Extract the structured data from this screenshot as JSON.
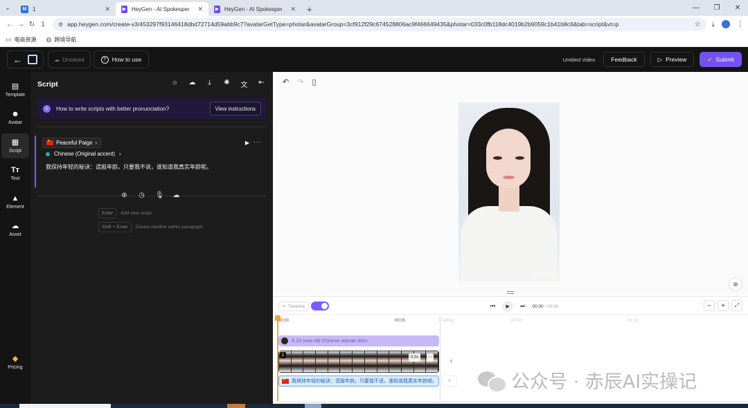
{
  "browser": {
    "tabs": [
      {
        "title": "1",
        "favicon": "1-favicon",
        "active": false
      },
      {
        "title": "HeyGen - AI Spokesperson V",
        "favicon": "heygen-favicon",
        "active": true
      },
      {
        "title": "HeyGen - AI Spokesperson V",
        "favicon": "heygen-favicon",
        "active": false
      }
    ],
    "reload_count": "1",
    "url": "app.heygen.com/create-v3/453297f93146418dbd72714d59abb9c7?avatarGetType=photar&avatarGroup=3cf912f29c674528806ac9f466649435&photar=033c0fb118dc4019b2b9059c1b41b8c6&tab=script&vt=p",
    "bookmarks": [
      "电商资源",
      "跨境导航"
    ]
  },
  "header": {
    "unsaved": "Unsaved",
    "how_to_use": "How to use",
    "video_title": "Untitled Video",
    "feedback": "Feedback",
    "preview": "Preview",
    "submit": "Submit"
  },
  "rail": {
    "items": [
      {
        "label": "Template",
        "icon": "template-icon"
      },
      {
        "label": "Avatar",
        "icon": "avatar-icon"
      },
      {
        "label": "Script",
        "icon": "script-icon",
        "active": true
      },
      {
        "label": "Text",
        "icon": "text-icon"
      },
      {
        "label": "Element",
        "icon": "element-icon"
      },
      {
        "label": "Asset",
        "icon": "asset-icon"
      }
    ],
    "pricing": "Pricing"
  },
  "script_panel": {
    "title": "Script",
    "tip_text": "How to write scripts with better pronunciation?",
    "tip_button": "View instructions",
    "voice_name": "Peaceful Paige",
    "accent": "Chinese (Original accent)",
    "script_text": "我保持年轻的秘诀：谎报年龄。只要我不说，谁知道我真实年龄呢。",
    "shortcuts": [
      {
        "key": "Enter",
        "desc": "Add new script"
      },
      {
        "key": "Shift + Enter",
        "desc": "Create newline within paragraph"
      }
    ]
  },
  "canvas": {
    "watermark": "HeyGen"
  },
  "timeline": {
    "mode_label": "Timeline",
    "current_time": "00:00",
    "duration": "/ 00:06",
    "ruler": [
      "00:00",
      "00:05",
      "Loading",
      "00:10",
      "00:15"
    ],
    "avatar_track_label": "A 23-year-old Chinese woman dres",
    "video_track_number": "1",
    "video_track_duration": "0.0s",
    "video_track_more": "···",
    "script_track_label": "我保持年轻的秘诀：谎报年龄。只要我不说，谁知道我真实年龄呢。",
    "frame_count": 13
  },
  "overlay_watermark": "公众号 · 赤辰AI实操记",
  "colors": {
    "accent": "#7352f0",
    "app_dark": "#141414",
    "panel": "#1c1c1c",
    "playhead": "#f5a623"
  }
}
